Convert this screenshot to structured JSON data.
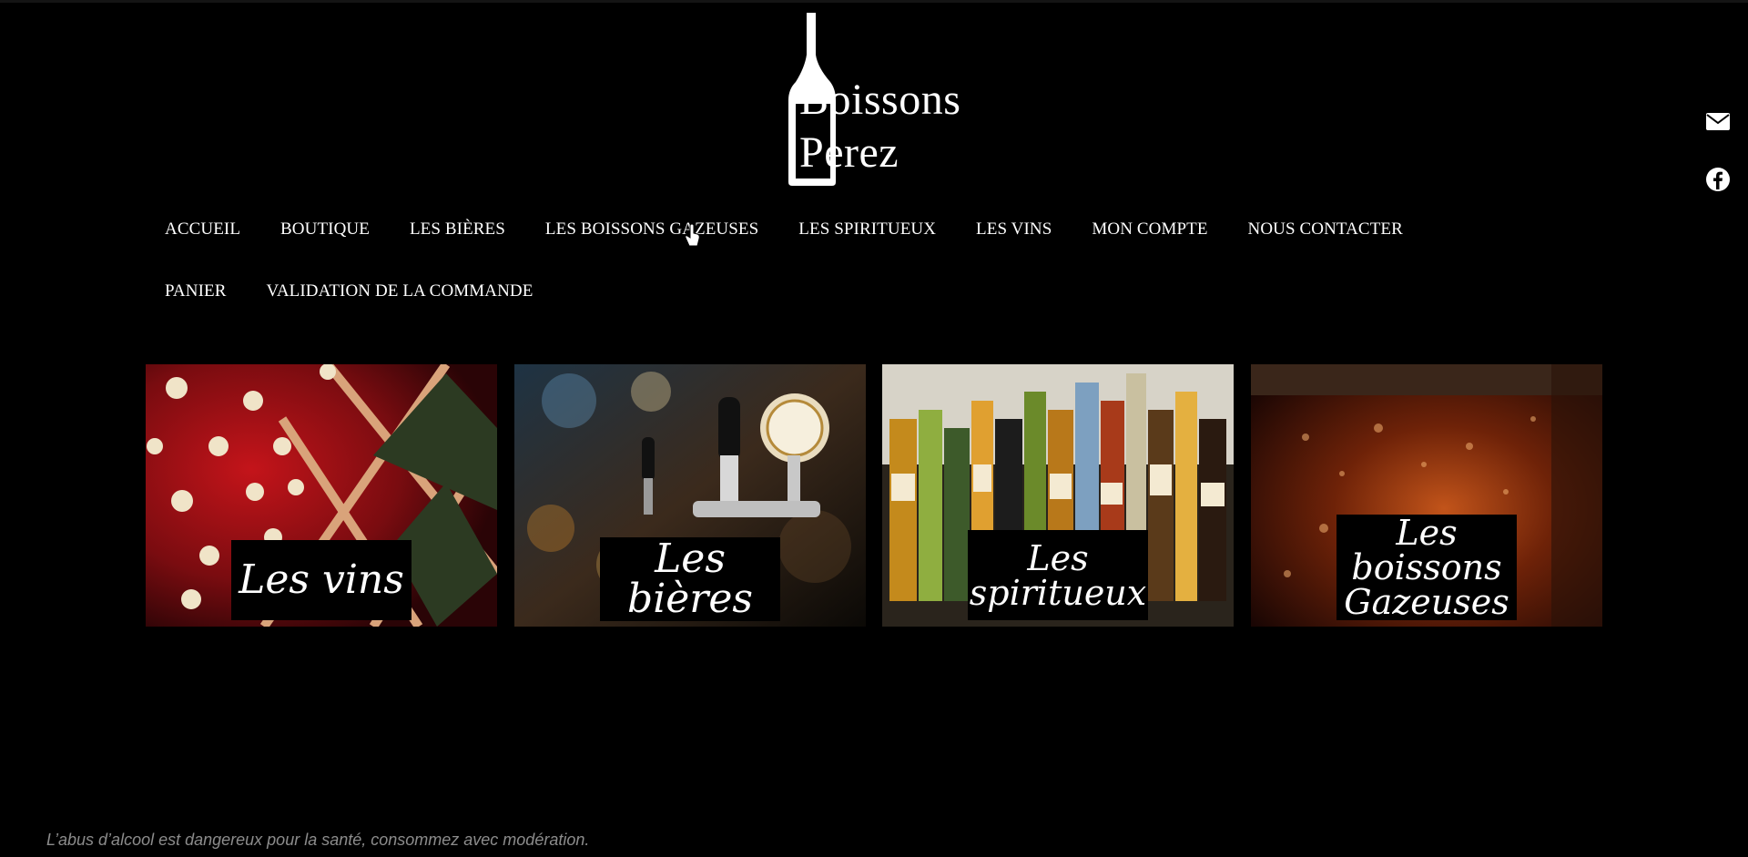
{
  "brand": {
    "line1": "Boissons",
    "line2": "Perez"
  },
  "social": [
    {
      "icon": "mail-icon"
    },
    {
      "icon": "facebook-icon"
    }
  ],
  "menu": {
    "row1": [
      "ACCUEIL",
      "BOUTIQUE",
      "LES BIÈRES",
      "LES BOISSONS GAZEUSES",
      "LES SPIRITUEUX",
      "LES VINS",
      "MON COMPTE",
      "NOUS CONTACTER"
    ],
    "row2": [
      "PANIER",
      "VALIDATION DE LA COMMANDE"
    ]
  },
  "categories": [
    {
      "label": "Les vins"
    },
    {
      "label": "Les bières"
    },
    {
      "label": "Les spiritueux"
    },
    {
      "label": "Les boissons Gazeuses"
    }
  ],
  "footer": {
    "note": "L’abus d’alcool est dangereux pour la santé, consommez avec modération."
  },
  "colors": {
    "background": "#000000",
    "text": "#ffffff",
    "footer_text": "#8c8c8c"
  }
}
